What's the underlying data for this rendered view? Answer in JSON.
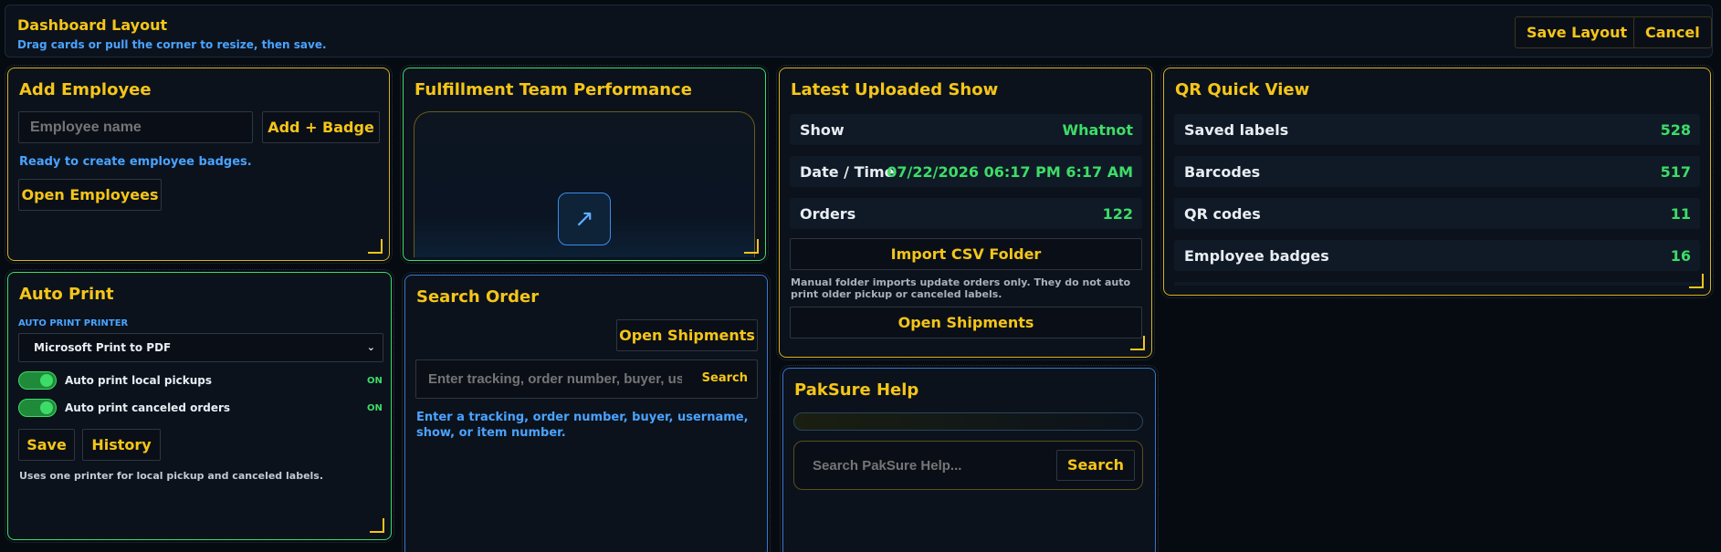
{
  "header": {
    "title": "Dashboard Layout",
    "subtitle": "Drag cards or pull the corner to resize, then save.",
    "save_label": "Save Layout",
    "cancel_label": "Cancel"
  },
  "add_employee": {
    "title": "Add Employee",
    "name_placeholder": "Employee name",
    "add_badge_label": "Add + Badge",
    "status": "Ready to create employee badges.",
    "open_label": "Open Employees"
  },
  "fulfillment": {
    "title": "Fulfillment Team Performance",
    "expand_icon": "↗"
  },
  "latest_show": {
    "title": "Latest Uploaded Show",
    "rows": [
      {
        "label": "Show",
        "value": "Whatnot"
      },
      {
        "label": "Date / Time",
        "value": "07/22/2026 06:17 PM 6:17 AM"
      },
      {
        "label": "Orders",
        "value": "122"
      }
    ],
    "import_label": "Import CSV Folder",
    "note": "Manual folder imports update orders only. They do not auto print older pickup or canceled labels.",
    "open_label": "Open Shipments"
  },
  "qr_view": {
    "title": "QR Quick View",
    "rows": [
      {
        "label": "Saved labels",
        "value": "528"
      },
      {
        "label": "Barcodes",
        "value": "517"
      },
      {
        "label": "QR codes",
        "value": "11"
      },
      {
        "label": "Employee badges",
        "value": "16"
      }
    ]
  },
  "auto_print": {
    "title": "Auto Print",
    "printer_label": "AUTO PRINT PRINTER",
    "printer_value": "Microsoft Print to PDF",
    "toggles": [
      {
        "label": "Auto print local pickups",
        "state": "ON"
      },
      {
        "label": "Auto print canceled orders",
        "state": "ON"
      }
    ],
    "save_label": "Save",
    "history_label": "History",
    "note": "Uses one printer for local pickup and canceled labels."
  },
  "search_order": {
    "title": "Search Order",
    "open_label": "Open Shipments",
    "placeholder": "Enter tracking, order number, buyer, username, show, or item number",
    "search_label": "Search",
    "hint": "Enter a tracking, order number, buyer, username, show, or item number."
  },
  "help": {
    "title": "PakSure Help",
    "placeholder": "Search PakSure Help...",
    "search_label": "Search"
  },
  "colors": {
    "accent_yellow": "#f5c518",
    "accent_blue": "#4aa3ff",
    "accent_green": "#3ddc67",
    "background": "#060b12"
  }
}
